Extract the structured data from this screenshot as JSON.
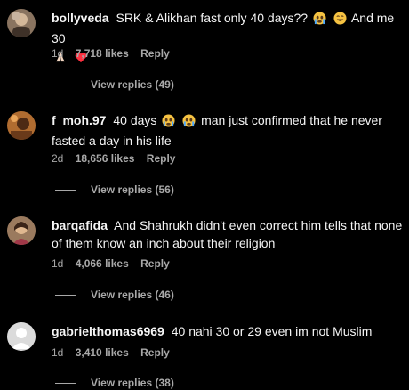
{
  "comments": [
    {
      "username": "bollyveda",
      "text_1": "SRK & Alikhan fast only 40 days??",
      "text_2": "And me 30",
      "time": "1d",
      "likes": "7,718 likes",
      "reply": "Reply",
      "view_replies": "View replies (49)"
    },
    {
      "username": "f_moh.97",
      "text_1": "40 days",
      "text_2": "man just confirmed that he never",
      "text_3": "fasted a day in his life",
      "time": "2d",
      "likes": "18,656 likes",
      "reply": "Reply",
      "view_replies": "View replies (56)"
    },
    {
      "username": "barqafida",
      "text_1": "And Shahrukh didn't even correct him tells that none",
      "text_2": "of them know an inch about their religion",
      "time": "1d",
      "likes": "4,066 likes",
      "reply": "Reply",
      "view_replies": "View replies (46)"
    },
    {
      "username": "gabrielthomas6969",
      "text_1": "40 nahi 30 or 29 even im not Muslim",
      "time": "1d",
      "likes": "3,410 likes",
      "reply": "Reply",
      "view_replies": "View replies (38)"
    }
  ],
  "colors": {
    "background": "#000000",
    "primary_text": "#f5f5f5",
    "secondary_text": "#a8a8a8",
    "heart": "#ff3040"
  },
  "icons": [
    "crying-face-emoji-icon",
    "laughing-face-emoji-icon",
    "praying-hands-emoji-icon",
    "red-heart-emoji-icon",
    "default-avatar-icon"
  ]
}
